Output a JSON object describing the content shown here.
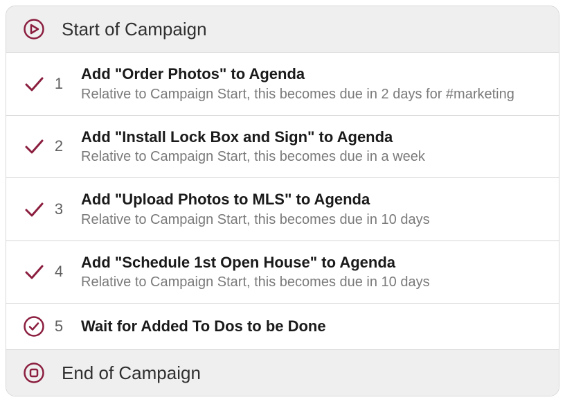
{
  "colors": {
    "accent": "#8b1e3f"
  },
  "header": {
    "title": "Start of Campaign"
  },
  "footer": {
    "title": "End of Campaign"
  },
  "steps": [
    {
      "num": "1",
      "title": "Add \"Order Photos\" to Agenda",
      "sub": "Relative to Campaign Start, this becomes due in 2 days for #marketing"
    },
    {
      "num": "2",
      "title": "Add \"Install Lock Box and Sign\" to Agenda",
      "sub": "Relative to Campaign Start, this becomes due in a week"
    },
    {
      "num": "3",
      "title": "Add \"Upload Photos to MLS\" to Agenda",
      "sub": "Relative to Campaign Start, this becomes due in 10 days"
    },
    {
      "num": "4",
      "title": "Add \"Schedule 1st Open House\" to Agenda",
      "sub": "Relative to Campaign Start, this becomes due in 10 days"
    },
    {
      "num": "5",
      "title": "Wait for Added To Dos to be Done",
      "sub": ""
    }
  ]
}
